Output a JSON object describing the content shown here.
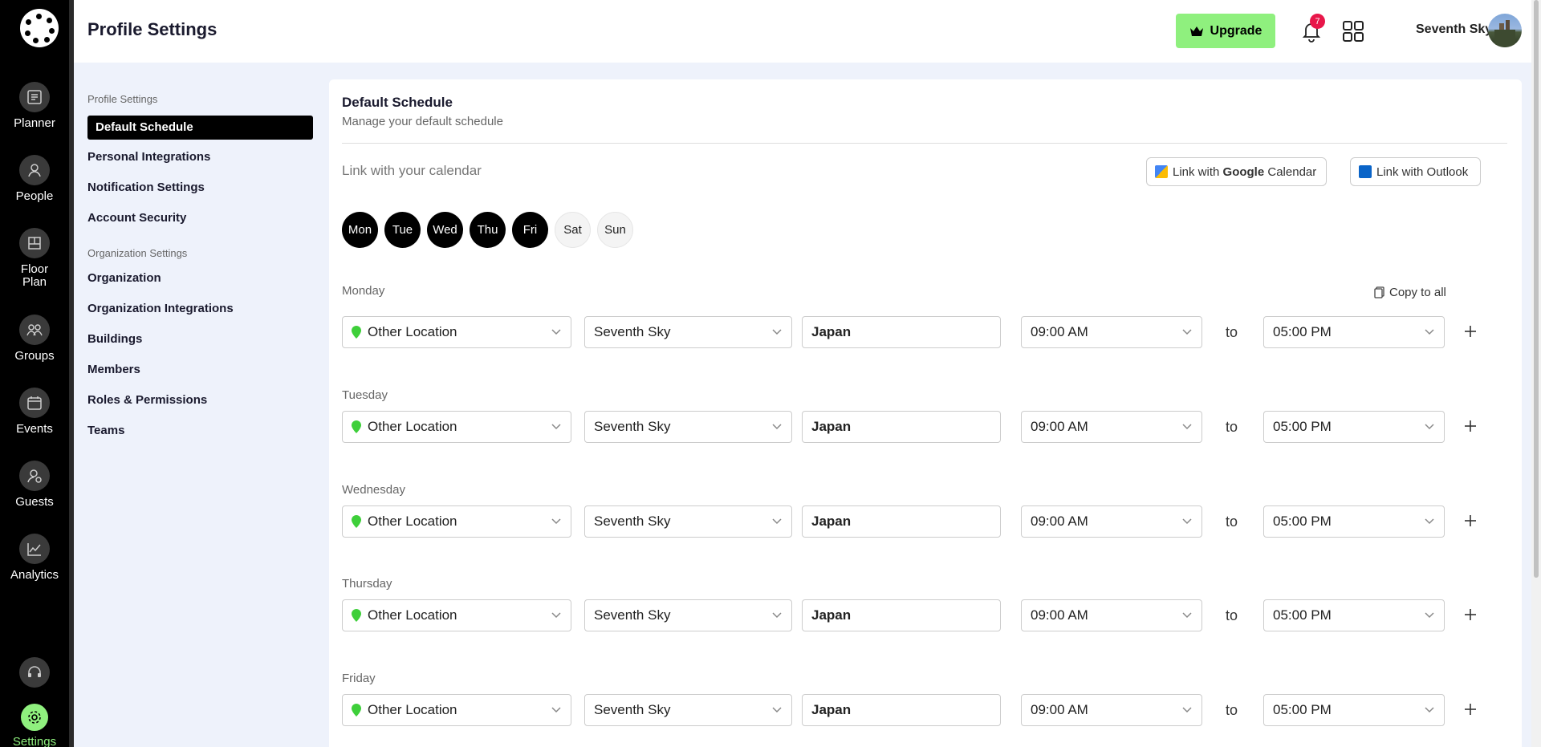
{
  "header": {
    "title": "Profile Settings",
    "upgrade_label": "Upgrade",
    "notification_count": "7",
    "user_name": "Seventh Sky"
  },
  "rail": {
    "items": [
      {
        "label": "Planner",
        "icon": "planner-icon"
      },
      {
        "label": "People",
        "icon": "person-icon"
      },
      {
        "label": "Floor Plan",
        "icon": "floorplan-icon"
      },
      {
        "label": "Groups",
        "icon": "groups-icon"
      },
      {
        "label": "Events",
        "icon": "calendar-icon"
      },
      {
        "label": "Guests",
        "icon": "guests-icon"
      },
      {
        "label": "Analytics",
        "icon": "chart-icon"
      }
    ],
    "support_icon": "headset-icon",
    "settings": {
      "label": "Settings",
      "icon": "gear-icon"
    }
  },
  "sidenav": {
    "profile_section": "Profile Settings",
    "profile_items": [
      "Default Schedule",
      "Personal Integrations",
      "Notification Settings",
      "Account Security"
    ],
    "org_section": "Organization Settings",
    "org_items": [
      "Organization",
      "Organization Integrations",
      "Buildings",
      "Members",
      "Roles & Permissions",
      "Teams"
    ]
  },
  "card": {
    "title": "Default Schedule",
    "subtitle": "Manage your default schedule",
    "link_label": "Link with your calendar",
    "google_btn_prefix": "Link with ",
    "google_btn_brand": "Google",
    "google_btn_suffix": " Calendar",
    "outlook_btn": "Link with Outlook",
    "copy_all": "Copy to all"
  },
  "days": [
    {
      "label": "Mon",
      "active": true
    },
    {
      "label": "Tue",
      "active": true
    },
    {
      "label": "Wed",
      "active": true
    },
    {
      "label": "Thu",
      "active": true
    },
    {
      "label": "Fri",
      "active": true
    },
    {
      "label": "Sat",
      "active": false
    },
    {
      "label": "Sun",
      "active": false
    }
  ],
  "schedule": [
    {
      "day": "Monday",
      "location": "Other Location",
      "person": "Seventh Sky",
      "place": "Japan",
      "start": "09:00 AM",
      "end": "05:00 PM"
    },
    {
      "day": "Tuesday",
      "location": "Other Location",
      "person": "Seventh Sky",
      "place": "Japan",
      "start": "09:00 AM",
      "end": "05:00 PM"
    },
    {
      "day": "Wednesday",
      "location": "Other Location",
      "person": "Seventh Sky",
      "place": "Japan",
      "start": "09:00 AM",
      "end": "05:00 PM"
    },
    {
      "day": "Thursday",
      "location": "Other Location",
      "person": "Seventh Sky",
      "place": "Japan",
      "start": "09:00 AM",
      "end": "05:00 PM"
    },
    {
      "day": "Friday",
      "location": "Other Location",
      "person": "Seventh Sky",
      "place": "Japan",
      "start": "09:00 AM",
      "end": "05:00 PM"
    }
  ],
  "to_label": "to",
  "colors": {
    "accent_green": "#8ff07e",
    "badge_red": "#e8174a",
    "pin_green": "#3ecf3a"
  }
}
